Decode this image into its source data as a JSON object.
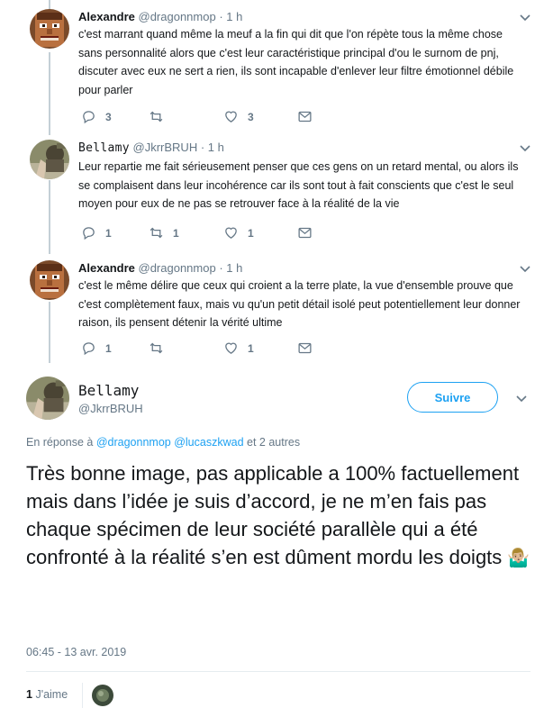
{
  "tweets": [
    {
      "name": "Alexandre",
      "handle": "@dragonnmop",
      "time": "· 1 h",
      "text": "c'est marrant quand même la meuf a la fin qui dit que l'on répète tous la même chose sans personnalité alors que c'est leur caractéristique principal d'ou le surnom de pnj, discuter avec eux ne sert a rien, ils sont incapable d'enlever leur filtre émotionnel débile pour parler",
      "replies": "3",
      "retweets": "",
      "likes": "3"
    },
    {
      "name": "Bellamy",
      "handle": "@JkrrBRUH",
      "time": "· 1 h",
      "text": "Leur repartie me fait sérieusement penser que ces gens on un retard mental, ou alors ils se complaisent dans leur incohérence car ils sont tout à fait conscients que c'est le seul moyen pour eux de ne pas se retrouver face à la réalité de la vie",
      "replies": "1",
      "retweets": "1",
      "likes": "1"
    },
    {
      "name": "Alexandre",
      "handle": "@dragonnmop",
      "time": "· 1 h",
      "text": "c'est le même délire que ceux qui croient a la terre plate, la vue d'ensemble prouve que c'est complètement faux, mais vu qu'un petit détail isolé peut potentiellement leur donner raison, ils pensent détenir la vérité ultime",
      "replies": "1",
      "retweets": "",
      "likes": "1"
    }
  ],
  "main": {
    "name": "Bellamy",
    "handle": "@JkrrBRUH",
    "follow_label": "Suivre",
    "reply_prefix": "En réponse à",
    "reply_user1": "@dragonnmop",
    "reply_user2": "@lucaszkwad",
    "reply_suffix": "et 2 autres",
    "text": "Très bonne image, pas applicable a 100% factuellement mais dans l’idée je suis d’accord, je ne m’en fais pas chaque spécimen de leur société parallèle qui a été confronté à la réalité s’en est dûment mordu les doigts",
    "emoji": "🤷🏼‍♂️",
    "timestamp": "06:45 - 13 avr. 2019",
    "likes_count": "1",
    "likes_label": "J'aime"
  },
  "colors": {
    "accent": "#1da1f2",
    "muted": "#657786",
    "thread": "#c4cfd6"
  },
  "icons": [
    "chevron-down-icon",
    "reply-icon",
    "retweet-icon",
    "like-icon",
    "message-icon"
  ]
}
